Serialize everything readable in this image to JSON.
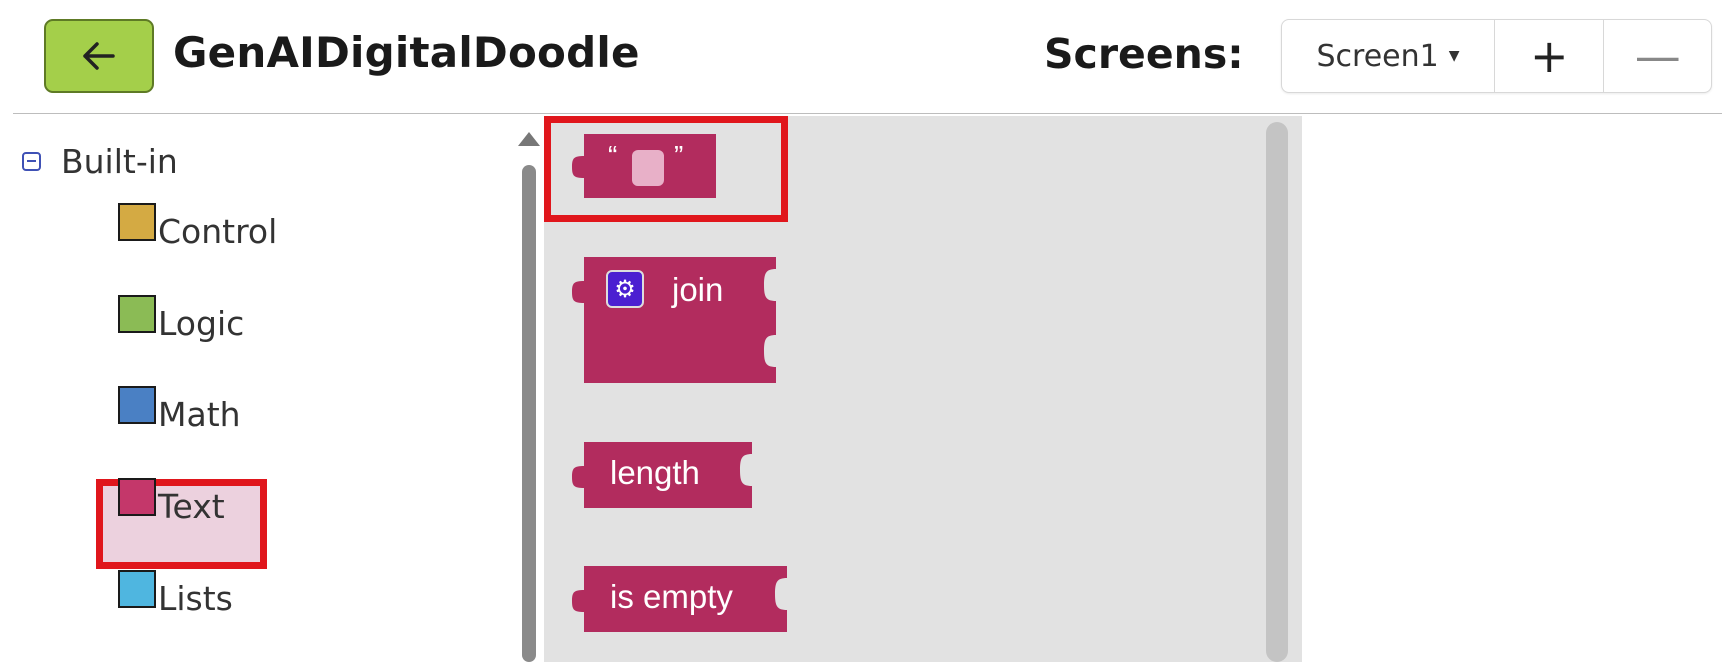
{
  "header": {
    "project_title": "GenAIDigitalDoodle",
    "screens_label": "Screens:",
    "screen_selected": "Screen1",
    "add_screen": "+",
    "remove_screen": "—"
  },
  "sidebar": {
    "group_label": "Built-in",
    "categories": [
      {
        "label": "Control",
        "color": "#d4aa43"
      },
      {
        "label": "Logic",
        "color": "#8bbb55"
      },
      {
        "label": "Math",
        "color": "#4a80c4"
      },
      {
        "label": "Text",
        "color": "#c4376a"
      },
      {
        "label": "Lists",
        "color": "#4fb6e0"
      }
    ],
    "selected": "Text"
  },
  "blocks": {
    "color": "#b22c5e",
    "string_open_quote": "“",
    "string_close_quote": "”",
    "join_label": "join",
    "length_label": "length",
    "is_empty_label": "is empty"
  },
  "colors": {
    "highlight": "#e0161c",
    "back_button": "#a4cf4a",
    "flyout_bg": "#e2e2e2"
  }
}
